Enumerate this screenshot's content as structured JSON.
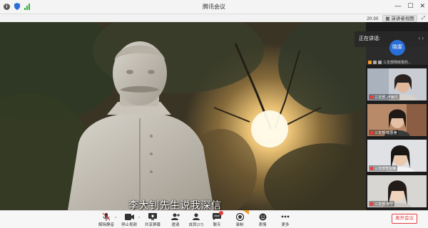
{
  "window": {
    "title": "腾讯会议"
  },
  "status": {
    "time": "20:30",
    "speaker_view_label": "演讲者视图"
  },
  "video": {
    "subtitle": "李大钊先生说我深信",
    "volume_badge": "◉ ))"
  },
  "panel": {
    "speaking_label": "正在讲话:",
    "self": {
      "avatar_text": "晓雯",
      "name": "三支部杨晓雯的..."
    },
    "participants": [
      {
        "name": "三支部_卢雨凡"
      },
      {
        "name": "三支部 喻晋滟"
      },
      {
        "name": "三支部李慧琳"
      },
      {
        "name": "三支部 罗宁"
      }
    ]
  },
  "toolbar": {
    "unmute": "解除静音",
    "stop_video": "停止视频",
    "share_screen": "共享屏幕",
    "invite": "邀请",
    "members": "成员(17)",
    "chat": "聊天",
    "record": "录制",
    "reactions": "表情",
    "more": "更多",
    "leave": "离开会议"
  },
  "colors": {
    "leave_red": "#e23c3c",
    "avatar_blue": "#2a6fd8",
    "signal_green": "#2fae3a",
    "record_orange": "#f39a2a"
  },
  "icons": [
    "info-icon",
    "shield-icon",
    "signal-icon",
    "minimize-icon",
    "maximize-icon",
    "close-icon",
    "mic-off-icon",
    "camera-icon",
    "screen-share-icon",
    "invite-icon",
    "members-icon",
    "chat-icon",
    "record-icon",
    "emoji-icon",
    "more-icon"
  ]
}
